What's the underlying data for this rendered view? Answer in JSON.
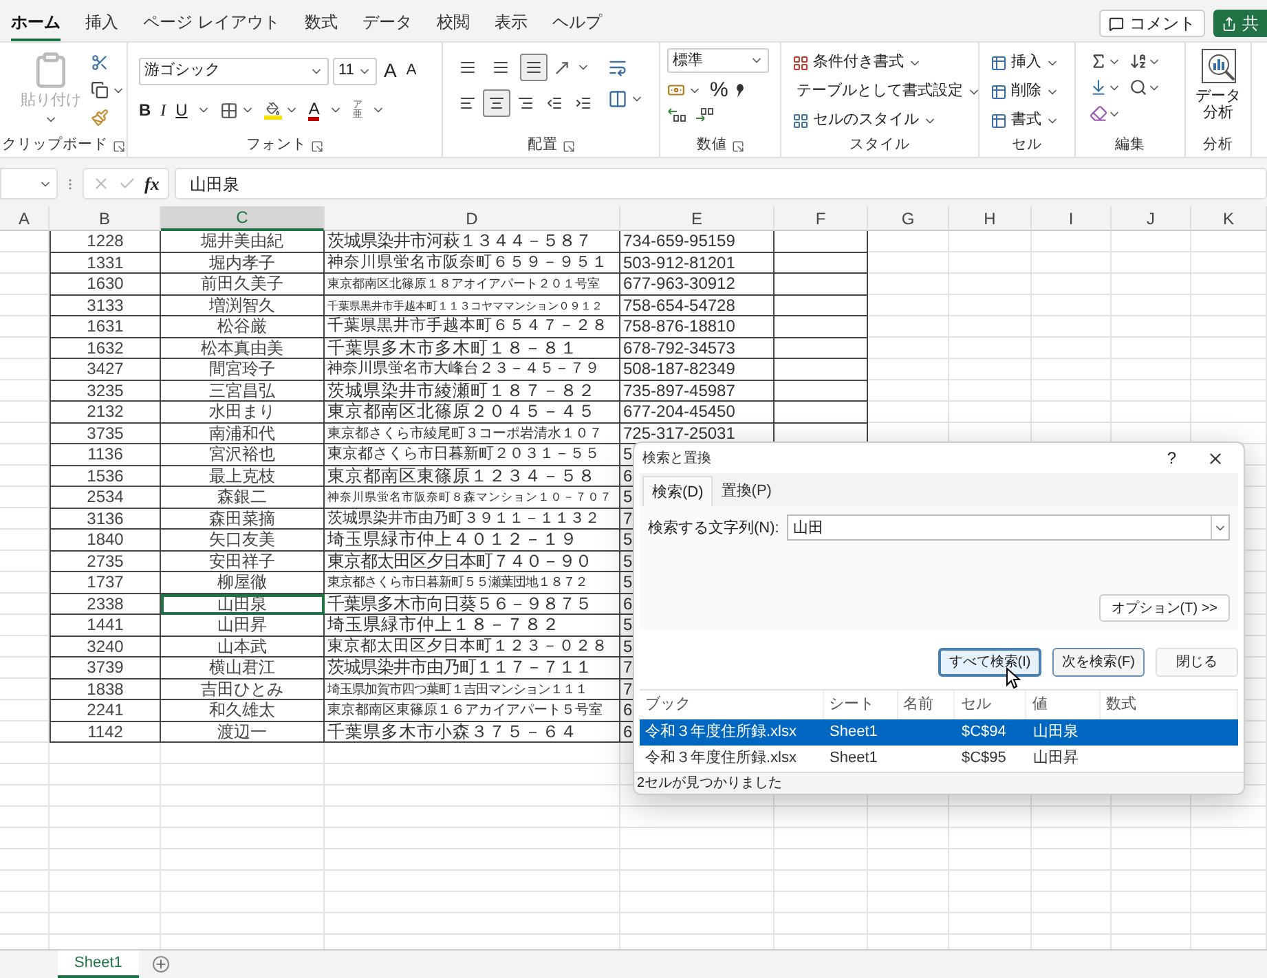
{
  "ribbon_tabs": [
    {
      "label": "ホーム",
      "selected": true
    },
    {
      "label": "挿入",
      "selected": false
    },
    {
      "label": "ページ レイアウト",
      "selected": false
    },
    {
      "label": "数式",
      "selected": false
    },
    {
      "label": "データ",
      "selected": false
    },
    {
      "label": "校閲",
      "selected": false
    },
    {
      "label": "表示",
      "selected": false
    },
    {
      "label": "ヘルプ",
      "selected": false
    }
  ],
  "header_buttons": {
    "comment": "コメント",
    "share": "共"
  },
  "ribbon": {
    "clipboard": {
      "paste": "貼り付け",
      "label": "クリップボード"
    },
    "font": {
      "name": "游ゴシック",
      "size": "11",
      "grow": "A",
      "shrink": "A",
      "bold": "B",
      "italic": "I",
      "underline": "U",
      "font_color_letter": "A",
      "phonetic": [
        "ア",
        "亜"
      ],
      "label": "フォント"
    },
    "alignment": {
      "vertical_buttons": [
        {
          "selected": false
        },
        {
          "selected": false
        },
        {
          "selected": true
        }
      ],
      "horizontal_buttons": [
        {
          "selected": false
        },
        {
          "selected": true
        },
        {
          "selected": false
        },
        {
          "selected": false
        },
        {
          "selected": false
        }
      ],
      "label": "配置"
    },
    "number": {
      "format": "標準",
      "percent": "%",
      "label": "数値"
    },
    "styles": {
      "items": [
        "条件付き書式",
        "テーブルとして書式設定",
        "セルのスタイル"
      ],
      "label": "スタイル"
    },
    "cells": {
      "items": [
        "挿入",
        "削除",
        "書式"
      ],
      "label": "セル"
    },
    "editing": {
      "label": "編集"
    },
    "analysis": {
      "button_lines": [
        "データ",
        "分析"
      ],
      "label": "分析"
    }
  },
  "formula_bar": {
    "fx": "fx",
    "value": "山田泉"
  },
  "columns": [
    {
      "label": "A",
      "selected": false
    },
    {
      "label": "B",
      "selected": false
    },
    {
      "label": "C",
      "selected": true
    },
    {
      "label": "D",
      "selected": false
    },
    {
      "label": "E",
      "selected": false
    },
    {
      "label": "F",
      "selected": false
    },
    {
      "label": "G",
      "selected": false
    },
    {
      "label": "H",
      "selected": false
    },
    {
      "label": "I",
      "selected": false
    },
    {
      "label": "J",
      "selected": false
    },
    {
      "label": "K",
      "selected": false
    }
  ],
  "rows": [
    {
      "id": "1228",
      "name": "堀井美由紀",
      "address": "茨城県染井市河萩１３４４－５８７",
      "phone": "734-659-95159",
      "selected": false
    },
    {
      "id": "1331",
      "name": "堀内孝子",
      "address": "神奈川県蛍名市阪奈町６５９－９５１",
      "phone": "503-912-81201",
      "selected": false
    },
    {
      "id": "1630",
      "name": "前田久美子",
      "address": "東京都南区北篠原１８アオイアパート２０１号室",
      "phone": "677-963-30912",
      "selected": false
    },
    {
      "id": "3133",
      "name": "増渕智久",
      "address": "千葉県黒井市手越本町１１３コヤママンション０９１２",
      "phone": "758-654-54728",
      "selected": false
    },
    {
      "id": "1631",
      "name": "松谷厳",
      "address": "千葉県黒井市手越本町６５４７－２８",
      "phone": "758-876-18810",
      "selected": false
    },
    {
      "id": "1632",
      "name": "松本真由美",
      "address": "千葉県多木市多木町１８－８１",
      "phone": "678-792-34573",
      "selected": false
    },
    {
      "id": "3427",
      "name": "間宮玲子",
      "address": "神奈川県蛍名市大峰台２３－４５－７９",
      "phone": "508-187-82349",
      "selected": false
    },
    {
      "id": "3235",
      "name": "三宮昌弘",
      "address": "茨城県染井市綾瀬町１８７－８２",
      "phone": "735-897-45987",
      "selected": false
    },
    {
      "id": "2132",
      "name": "水田まり",
      "address": "東京都南区北篠原２０４５－４５",
      "phone": "677-204-45450",
      "selected": false
    },
    {
      "id": "3735",
      "name": "南浦和代",
      "address": "東京都さくら市綾尾町３コーポ岩清水１０７",
      "phone": "725-317-25031",
      "selected": false
    },
    {
      "id": "1136",
      "name": "宮沢裕也",
      "address": "東京都さくら市日暮新町２０３１－５５",
      "phone": "5",
      "selected": false
    },
    {
      "id": "1536",
      "name": "最上克枝",
      "address": "東京都南区東篠原１２３４－５８",
      "phone": "6",
      "selected": false
    },
    {
      "id": "2534",
      "name": "森銀二",
      "address": "神奈川県蛍名市阪奈町８森マンション１０－７０７",
      "phone": "5",
      "selected": false
    },
    {
      "id": "3136",
      "name": "森田菜摘",
      "address": "茨城県染井市由乃町３９１１－１１３２",
      "phone": "7",
      "selected": false
    },
    {
      "id": "1840",
      "name": "矢口友美",
      "address": "埼玉県緑市仲上４０１２－１９",
      "phone": "5",
      "selected": false
    },
    {
      "id": "2735",
      "name": "安田祥子",
      "address": "東京都太田区夕日本町７４０－９０",
      "phone": "5",
      "selected": false
    },
    {
      "id": "1737",
      "name": "柳屋徹",
      "address": "東京都さくら市日暮新町５５瀬葉団地１８７２",
      "phone": "5",
      "selected": false
    },
    {
      "id": "2338",
      "name": "山田泉",
      "address": "千葉県多木市向日葵５６－９８７５",
      "phone": "6",
      "selected": true
    },
    {
      "id": "1441",
      "name": "山田昇",
      "address": "埼玉県緑市仲上１８－７８２",
      "phone": "5",
      "selected": false
    },
    {
      "id": "3240",
      "name": "山本武",
      "address": "東京都太田区夕日本町１２３－０２８",
      "phone": "5",
      "selected": false
    },
    {
      "id": "3739",
      "name": "横山君江",
      "address": "茨城県染井市由乃町１１７－７１１",
      "phone": "7",
      "selected": false
    },
    {
      "id": "1838",
      "name": "吉田ひとみ",
      "address": "埼玉県加賀市四つ葉町１吉田マンション１１１",
      "phone": "7",
      "selected": false
    },
    {
      "id": "2241",
      "name": "和久雄太",
      "address": "東京都南区東篠原１６アカイアパート５号室",
      "phone": "6",
      "selected": false
    },
    {
      "id": "1142",
      "name": "渡辺一",
      "address": "千葉県多木市小森３７５－６４",
      "phone": "6",
      "selected": false
    }
  ],
  "dialog": {
    "title": "検索と置換",
    "help": "?",
    "tabs": [
      {
        "label": "検索(D)",
        "selected": true
      },
      {
        "label": "置換(P)",
        "selected": false
      }
    ],
    "find_label": "検索する文字列(N):",
    "find_value": "山田",
    "options_button": "オプション(T) >>",
    "buttons": [
      {
        "label": "すべて検索(I)",
        "kind": "focused"
      },
      {
        "label": "次を検索(F)",
        "kind": "default"
      },
      {
        "label": "閉じる",
        "kind": "plain"
      }
    ],
    "result_columns": [
      "ブック",
      "シート",
      "名前",
      "セル",
      "値",
      "数式"
    ],
    "results": [
      {
        "book": "令和３年度住所録.xlsx",
        "sheet": "Sheet1",
        "cell": "$C$94",
        "value": "山田泉",
        "selected": true
      },
      {
        "book": "令和３年度住所録.xlsx",
        "sheet": "Sheet1",
        "cell": "$C$95",
        "value": "山田昇",
        "selected": false
      }
    ],
    "status": "2セルが見つかりました"
  },
  "sheet_tabs": [
    {
      "label": "Sheet1",
      "selected": true
    }
  ]
}
